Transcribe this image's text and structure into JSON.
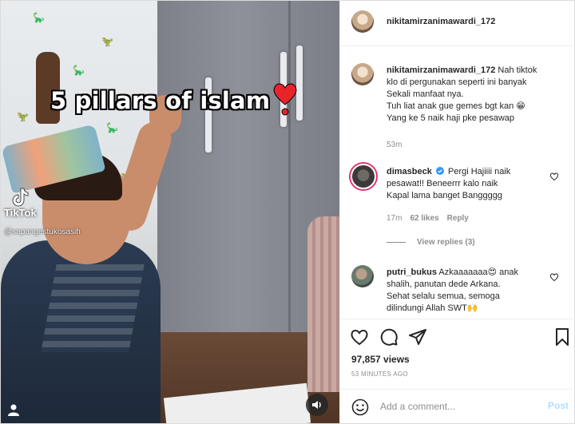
{
  "video": {
    "overlay_caption": "5 pillars of islam",
    "tiktok_label": "TikTok",
    "tiktok_username": "@sapangestukosasih",
    "icons": [
      "heart-icon",
      "tiktok-icon",
      "profile-icon",
      "speaker-icon"
    ]
  },
  "header": {
    "username": "nikitamirzanimawardi_172",
    "icons": [
      "avatar"
    ]
  },
  "caption": {
    "username": "nikitamirzanimawardi_172",
    "lines": [
      "Nah tiktok",
      "klo di pergunakan seperti ini banyak",
      "Sekali manfaat nya.",
      "Tuh liat anak gue gemes bgt kan 😁",
      "Yang ke 5 naik haji pke pesawap"
    ],
    "time": "53m"
  },
  "comments": [
    {
      "username": "dimasbeck",
      "verified": true,
      "lines": [
        "Pergi Hajiiii naik",
        "pesawat!! Beneerrr kalo naik",
        "Kapal lama banget Banggggg"
      ],
      "time": "17m",
      "likes": "62 likes",
      "reply_label": "Reply",
      "view_replies": "View replies (3)"
    },
    {
      "username": "putri_bukus",
      "verified": false,
      "lines": [
        "Azkaaaaaaa😍 anak",
        "shalih, panutan dede Arkana.",
        "Sehat selalu semua, semoga",
        "dilindungi Allah SWT🙌"
      ]
    }
  ],
  "actions": {
    "views": "97,857 views",
    "time_ago": "53 MINUTES AGO",
    "icons": [
      "like-icon",
      "comment-icon",
      "share-icon",
      "bookmark-icon"
    ]
  },
  "add_comment": {
    "placeholder": "Add a comment...",
    "post_label": "Post"
  },
  "colors": {
    "accent_blue": "#0095f6",
    "post_disabled": "#b2dffc",
    "heart_red": "#e8242b",
    "muted_text": "#8e8e8e"
  }
}
